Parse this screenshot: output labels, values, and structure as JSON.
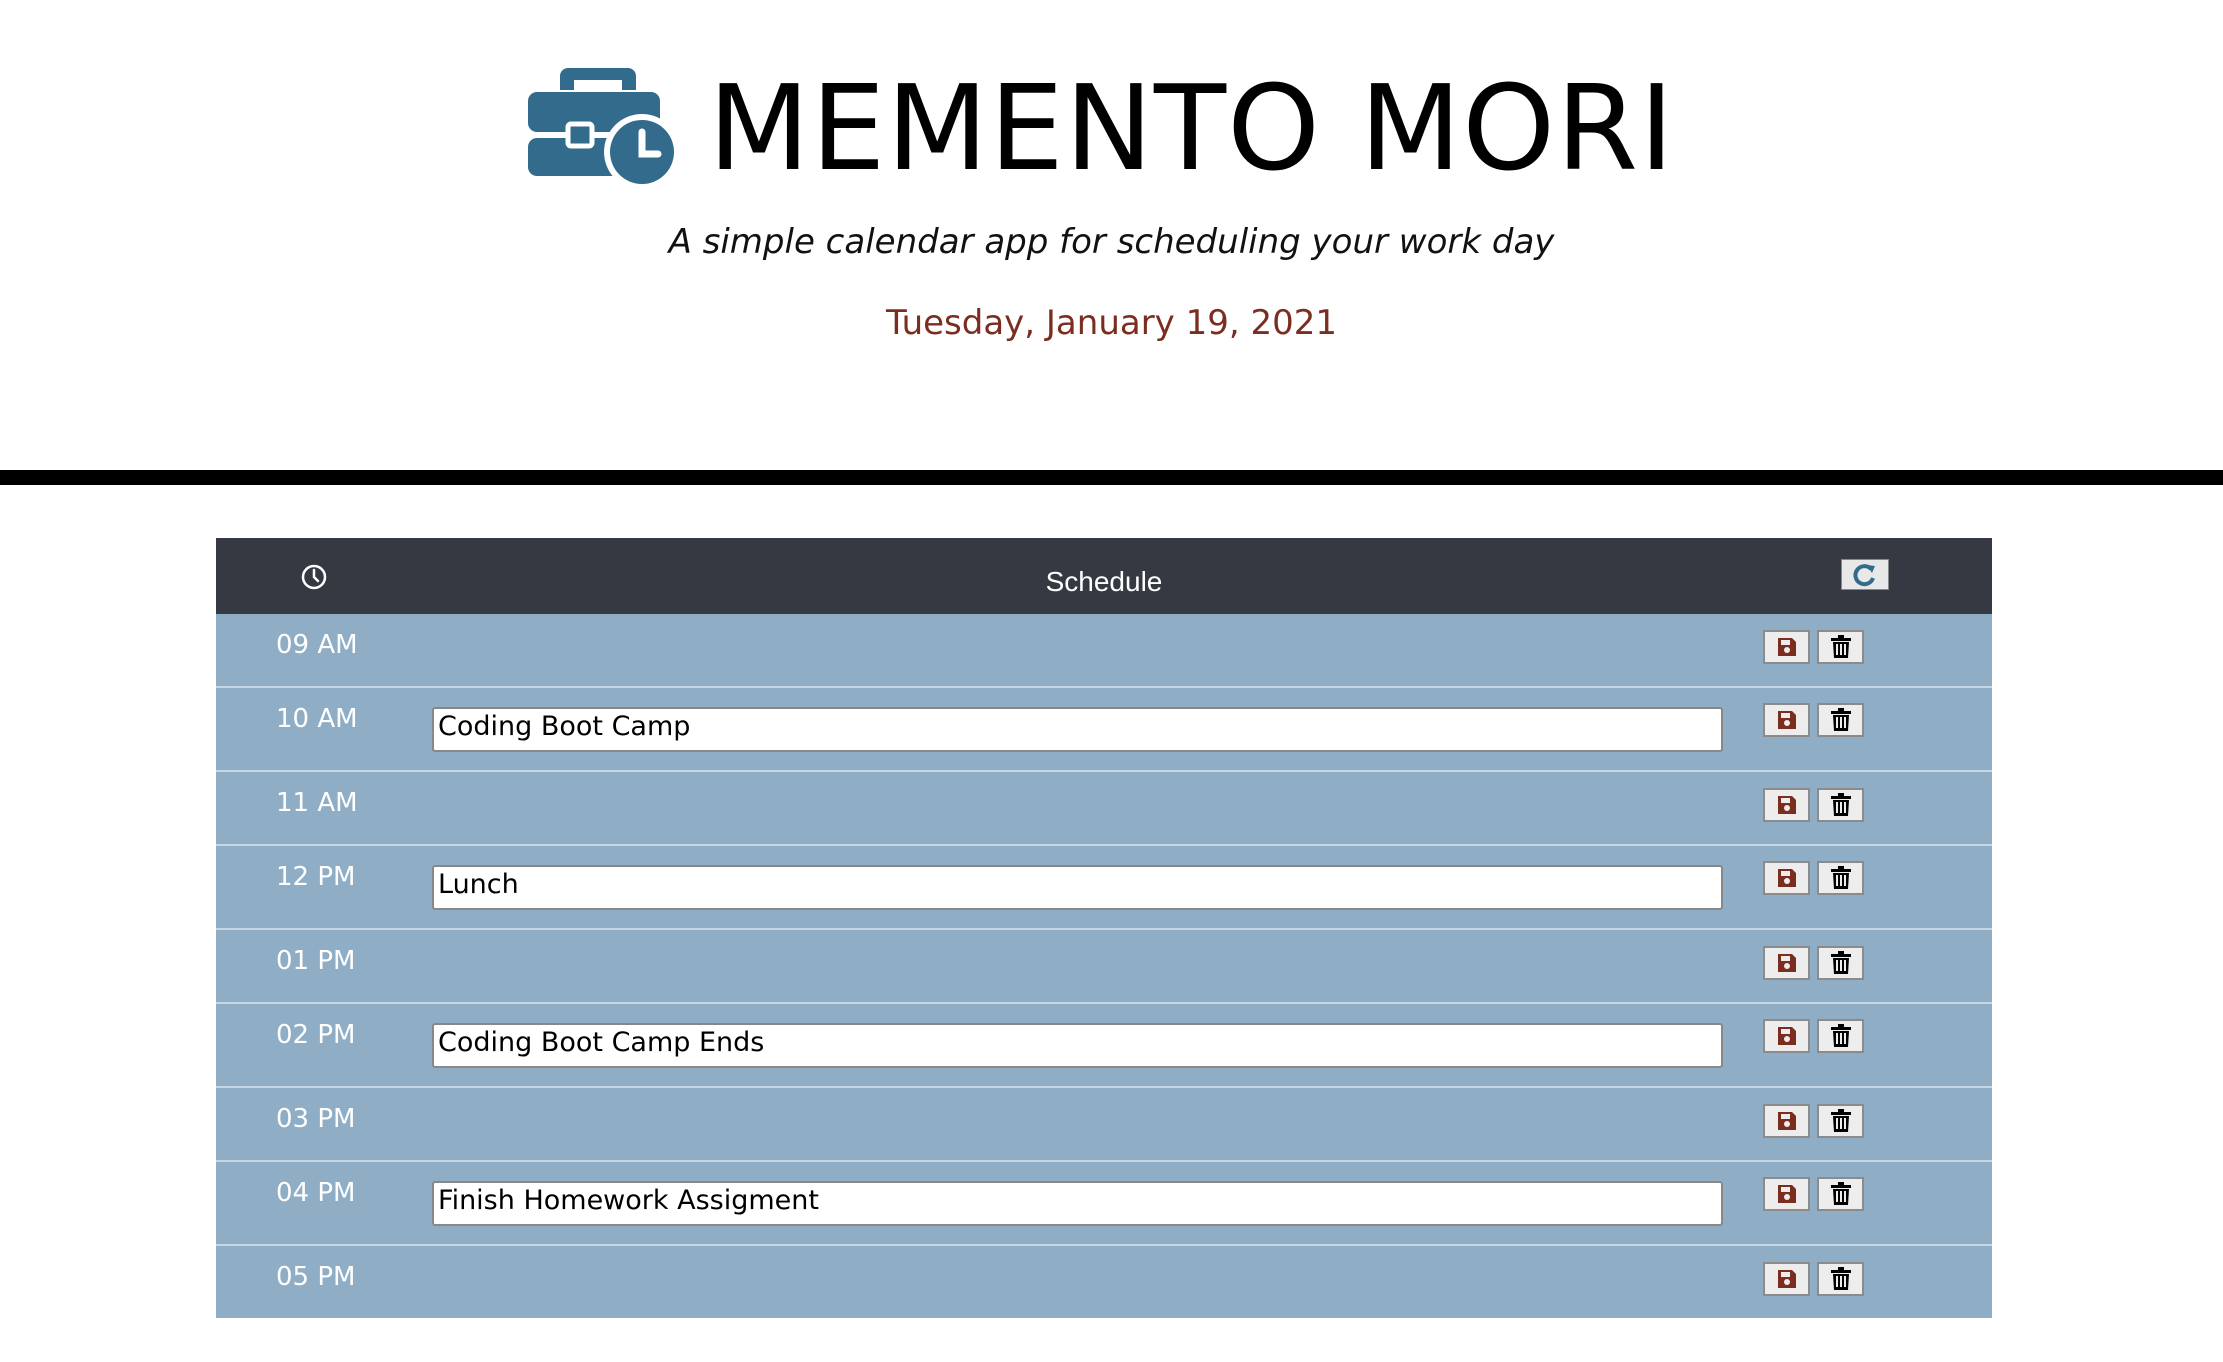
{
  "header": {
    "icon": "briefcase-clock-icon",
    "title": "MEMENTO MORI",
    "subtitle": "A simple calendar app for scheduling your work day",
    "date": "Tuesday, January 19, 2021"
  },
  "colors": {
    "logo": "#336b8c",
    "date": "#7b2e20",
    "schedule_header_bg": "#353a42",
    "row_bg": "#8faec5",
    "save_icon": "#7b2e20",
    "trash_icon": "#000000"
  },
  "schedule": {
    "clock_icon": "clock-icon",
    "title": "Schedule",
    "refresh_icon": "refresh-icon",
    "rows": [
      {
        "hour": "09 AM",
        "task": ""
      },
      {
        "hour": "10 AM",
        "task": "Coding Boot Camp"
      },
      {
        "hour": "11 AM",
        "task": ""
      },
      {
        "hour": "12 PM",
        "task": "Lunch"
      },
      {
        "hour": "01 PM",
        "task": ""
      },
      {
        "hour": "02 PM",
        "task": "Coding Boot Camp Ends"
      },
      {
        "hour": "03 PM",
        "task": ""
      },
      {
        "hour": "04 PM",
        "task": "Finish Homework Assigment"
      },
      {
        "hour": "05 PM",
        "task": ""
      }
    ],
    "save_icon": "save-icon",
    "delete_icon": "trash-icon"
  }
}
